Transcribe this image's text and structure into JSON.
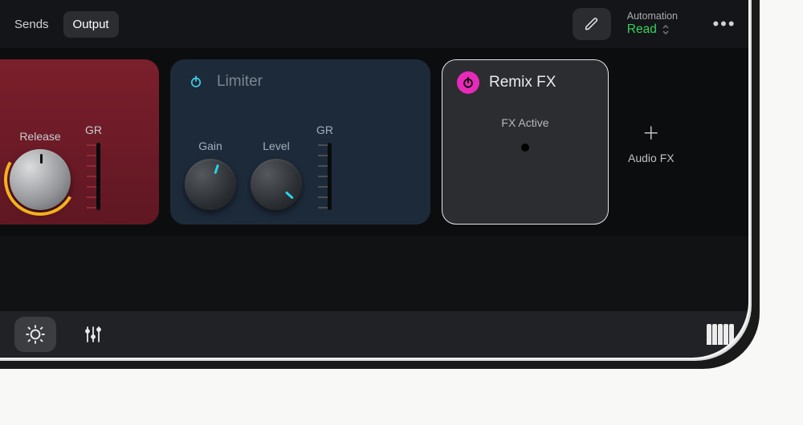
{
  "tabs": {
    "sends": "Sends",
    "output": "Output",
    "active": "output"
  },
  "automation": {
    "label": "Automation",
    "value": "Read"
  },
  "plugin_a": {
    "knob_release": "Release",
    "gr_label": "GR"
  },
  "plugin_b": {
    "title": "Limiter",
    "knob_gain": "Gain",
    "knob_level": "Level",
    "gr_label": "GR"
  },
  "plugin_c": {
    "title": "Remix FX",
    "sub": "FX Active"
  },
  "addfx": {
    "label": "Audio FX"
  }
}
